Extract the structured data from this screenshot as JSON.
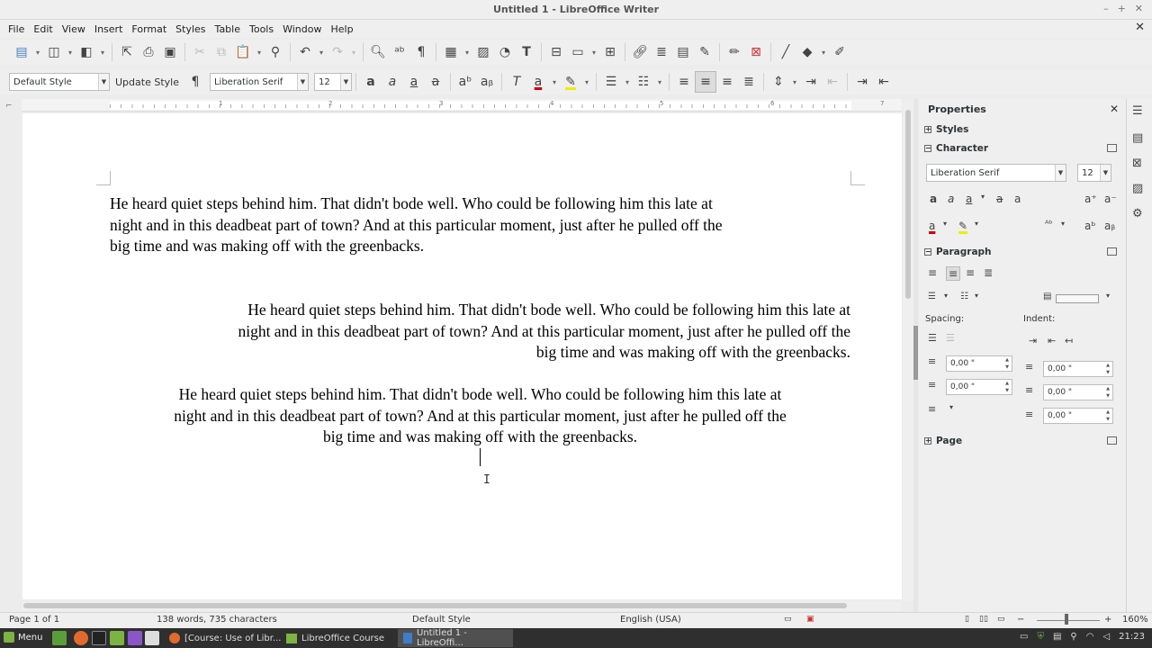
{
  "window": {
    "title": "Untitled 1 - LibreOffice Writer"
  },
  "menu": [
    "File",
    "Edit",
    "View",
    "Insert",
    "Format",
    "Styles",
    "Table",
    "Tools",
    "Window",
    "Help"
  ],
  "formatting": {
    "paragraph_style": "Default Style",
    "update_style": "Update Style",
    "font_name": "Liberation Serif",
    "font_size": "12"
  },
  "ruler": {
    "numbers": [
      "1",
      "2",
      "3",
      "4",
      "5",
      "6",
      "7"
    ]
  },
  "document": {
    "paragraphs": [
      {
        "align": "left",
        "lines": [
          "He heard quiet steps behind him. That didn't bode well. Who could be following him this late at",
          "night and in this deadbeat part of town? And at this particular moment, just after he pulled off the",
          "big time and was making off with the greenbacks."
        ]
      },
      {
        "align": "right",
        "lines": [
          "He heard quiet steps behind him. That didn't bode well. Who could be following him this late at",
          "night and in this deadbeat part of town? And at this particular moment, just after he pulled off the",
          "big time and was making off with the greenbacks."
        ]
      },
      {
        "align": "center",
        "lines": [
          "He heard quiet steps behind him. That didn't bode well. Who could be following him this late at",
          "night and in this deadbeat part of town? And at this particular moment, just after he pulled off the",
          "big time and was making off with the greenbacks."
        ]
      }
    ]
  },
  "sidebar": {
    "title": "Properties",
    "sections": {
      "styles": "Styles",
      "character": "Character",
      "paragraph": "Paragraph",
      "page": "Page"
    },
    "font_name": "Liberation Serif",
    "font_size": "12",
    "spacing_label": "Spacing:",
    "indent_label": "Indent:",
    "spacing_above": "0,00 \"",
    "spacing_below": "0,00 \"",
    "indent_before": "0,00 \"",
    "indent_after": "0,00 \"",
    "indent_first": "0,00 \""
  },
  "status": {
    "page": "Page 1 of 1",
    "words": "138 words, 735 characters",
    "style": "Default Style",
    "language": "English (USA)",
    "zoom": "160%"
  },
  "taskbar": {
    "menu_label": "Menu",
    "tasks": [
      "[Course: Use of Libr...",
      "LibreOffice Course",
      "Untitled 1 - LibreOffi..."
    ],
    "clock": "21:23"
  }
}
